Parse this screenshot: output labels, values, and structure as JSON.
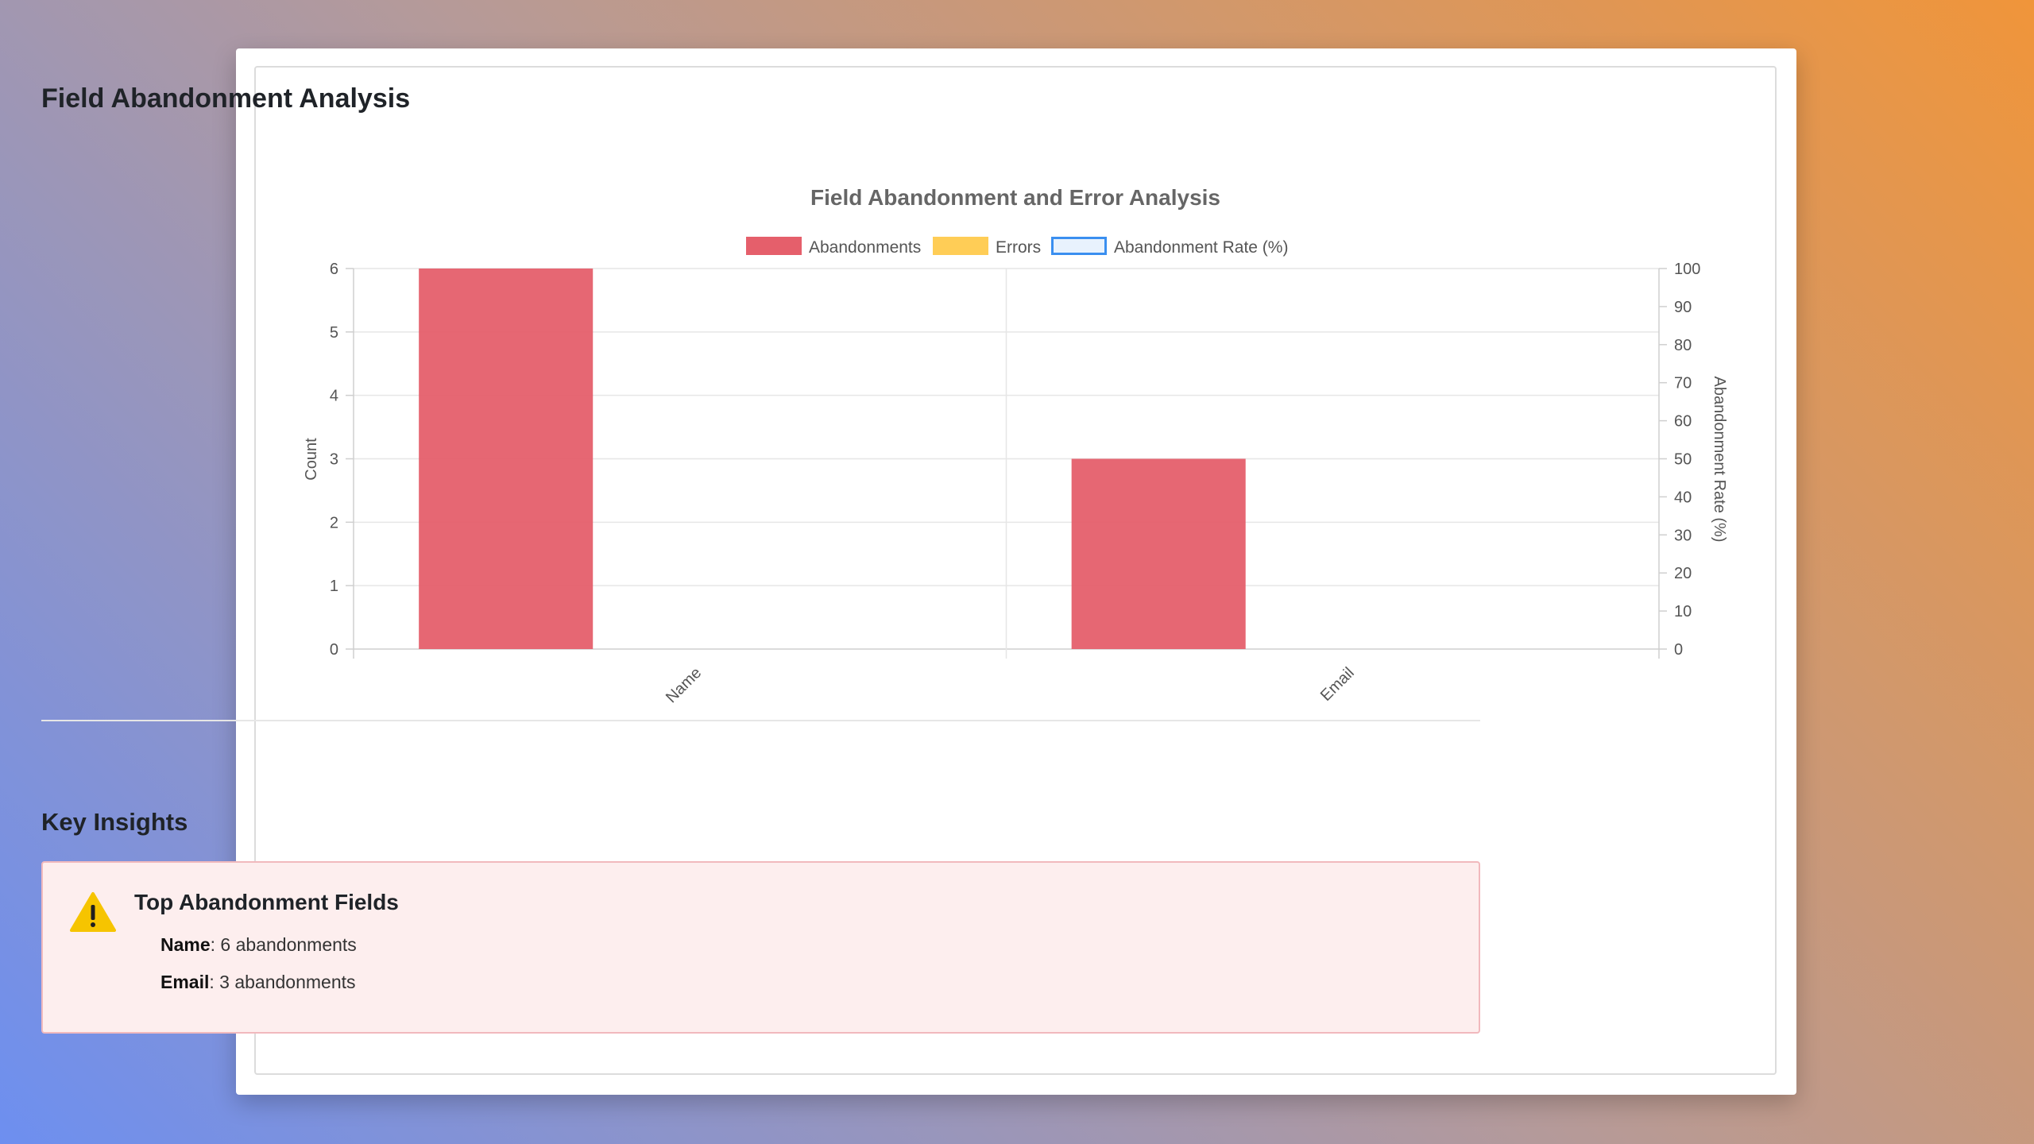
{
  "page": {
    "title": "Field Abandonment Analysis",
    "insights_heading": "Key Insights"
  },
  "insight_card": {
    "icon": "warning-icon",
    "title": "Top Abandonment Fields",
    "items": [
      {
        "field": "Name",
        "text": ": 6 abandonments"
      },
      {
        "field": "Email",
        "text": ": 3 abandonments"
      }
    ]
  },
  "colors": {
    "abandonments": "#e55f6b",
    "errors": "#ffcd56",
    "rate_border": "#3a8ff0",
    "rate_fill": "#e8f2fd"
  },
  "chart_data": {
    "type": "bar",
    "title": "Field Abandonment and Error Analysis",
    "categories": [
      "Name",
      "Email"
    ],
    "series": [
      {
        "name": "Abandonments",
        "axis": "left",
        "values": [
          6,
          3
        ]
      },
      {
        "name": "Errors",
        "axis": "left",
        "values": [
          0,
          0
        ]
      },
      {
        "name": "Abandonment Rate (%)",
        "axis": "right",
        "values": [
          0,
          0
        ]
      }
    ],
    "ylabel": "Count",
    "ylabel_right": "Abandonment Rate (%)",
    "ylim": [
      0,
      6
    ],
    "ylim_right": [
      0,
      100
    ],
    "yticks": [
      0,
      1,
      2,
      3,
      4,
      5,
      6
    ],
    "yticks_right": [
      0,
      10,
      20,
      30,
      40,
      50,
      60,
      70,
      80,
      90,
      100
    ],
    "legend": "top",
    "grid": true
  }
}
